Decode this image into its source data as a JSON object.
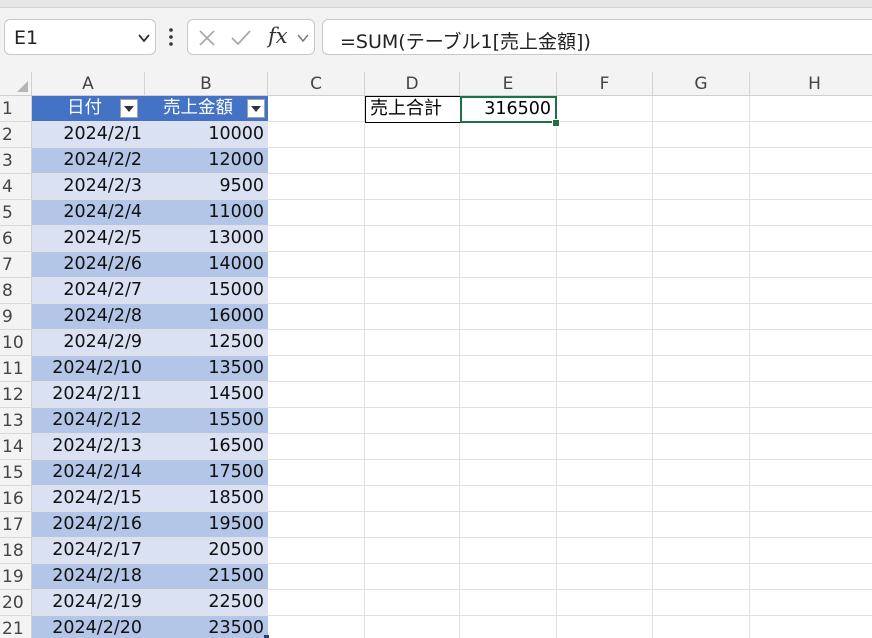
{
  "formula_bar": {
    "name_box": "E1",
    "fx_label": "fx",
    "formula": "=SUM(テーブル1[売上金額])"
  },
  "columns": [
    "A",
    "B",
    "C",
    "D",
    "E",
    "F",
    "G",
    "H"
  ],
  "rows": [
    "1",
    "2",
    "3",
    "4",
    "5",
    "6",
    "7",
    "8",
    "9",
    "10",
    "11",
    "12",
    "13",
    "14",
    "15",
    "16",
    "17",
    "18",
    "19",
    "20",
    "21"
  ],
  "table": {
    "headers": [
      "日付",
      "売上金額"
    ],
    "rows": [
      [
        "2024/2/1",
        "10000"
      ],
      [
        "2024/2/2",
        "12000"
      ],
      [
        "2024/2/3",
        "9500"
      ],
      [
        "2024/2/4",
        "11000"
      ],
      [
        "2024/2/5",
        "13000"
      ],
      [
        "2024/2/6",
        "14000"
      ],
      [
        "2024/2/7",
        "15000"
      ],
      [
        "2024/2/8",
        "16000"
      ],
      [
        "2024/2/9",
        "12500"
      ],
      [
        "2024/2/10",
        "13500"
      ],
      [
        "2024/2/11",
        "14500"
      ],
      [
        "2024/2/12",
        "15500"
      ],
      [
        "2024/2/13",
        "16500"
      ],
      [
        "2024/2/14",
        "17500"
      ],
      [
        "2024/2/15",
        "18500"
      ],
      [
        "2024/2/16",
        "19500"
      ],
      [
        "2024/2/17",
        "20500"
      ],
      [
        "2024/2/18",
        "21500"
      ],
      [
        "2024/2/19",
        "22500"
      ],
      [
        "2024/2/20",
        "23500"
      ]
    ]
  },
  "summary": {
    "label": "売上合計",
    "value": "316500"
  },
  "colors": {
    "table_header": "#4472c4",
    "band_dark": "#b4c6e7",
    "band_light": "#d9e1f2",
    "selection": "#1e7145"
  }
}
